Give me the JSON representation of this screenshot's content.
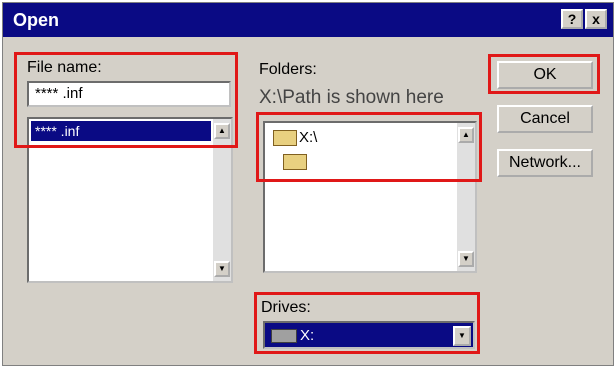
{
  "window": {
    "title": "Open",
    "help_button": "?",
    "close_button": "x"
  },
  "file_name": {
    "label": "File name:",
    "value": "**** .inf",
    "list_items": [
      "**** .inf"
    ]
  },
  "folders": {
    "label": "Folders:",
    "path_hint": "X:\\Path is shown here",
    "items": [
      "X:\\",
      ""
    ]
  },
  "drives": {
    "label": "Drives:",
    "selected": "X:"
  },
  "buttons": {
    "ok": "OK",
    "cancel": "Cancel",
    "network": "Network..."
  },
  "annotation_color": "#e01818"
}
